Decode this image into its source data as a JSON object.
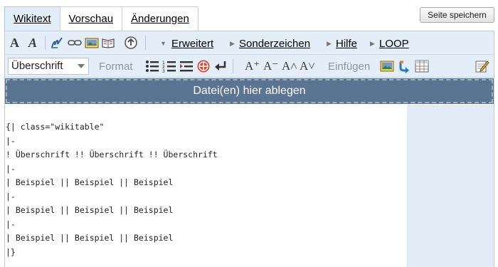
{
  "tabs": [
    {
      "label": "Wikitext"
    },
    {
      "label": "Vorschau"
    },
    {
      "label": "Änderungen"
    }
  ],
  "save_button": "Seite speichern",
  "toolbar1": {
    "bold": "A",
    "italic": "A",
    "icons": [
      "signature-icon",
      "link-icon",
      "image-icon",
      "book-icon",
      "upload-icon"
    ],
    "menus": [
      "Erweitert",
      "Sonderzeichen",
      "Hilfe",
      "LOOP"
    ]
  },
  "toolbar2": {
    "heading_select": "Überschrift",
    "format_label": "Format",
    "text_sizes": [
      "A⁺",
      "A⁻",
      "A˄",
      "A˅"
    ],
    "insert_label": "Einfügen"
  },
  "dropzone": "Datei(en) hier ablegen",
  "content_lines": [
    "{| class=\"wikitable\"",
    "|-",
    "! Überschrift !! Überschrift !! Überschrift",
    "|-",
    "| Beispiel || Beispiel || Beispiel",
    "|-",
    "| Beispiel || Beispiel || Beispiel",
    "|-",
    "| Beispiel || Beispiel || Beispiel",
    "|}"
  ],
  "colors": {
    "toolbar_bg": "#e4eef8",
    "dropzone_bg": "#5b7491",
    "sidepanel_bg": "#e1ecf6"
  }
}
